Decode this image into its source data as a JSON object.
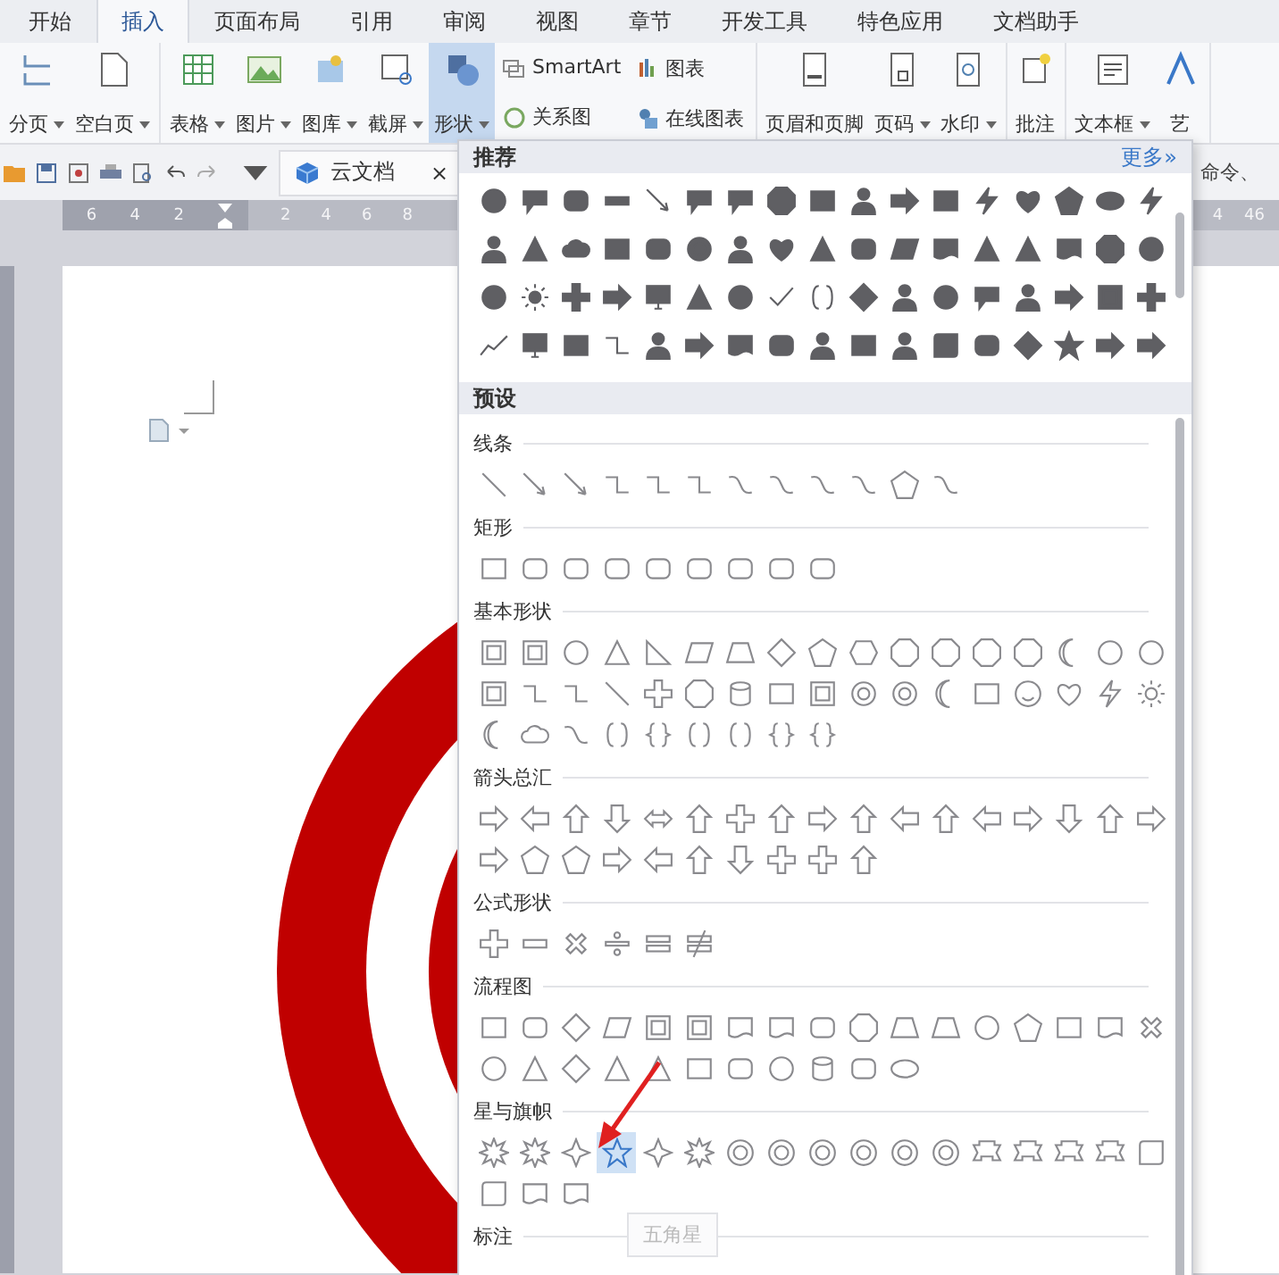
{
  "tabs": [
    {
      "label": "开始",
      "selected": false
    },
    {
      "label": "插入",
      "selected": true
    },
    {
      "label": "页面布局",
      "selected": false
    },
    {
      "label": "引用",
      "selected": false
    },
    {
      "label": "审阅",
      "selected": false
    },
    {
      "label": "视图",
      "selected": false
    },
    {
      "label": "章节",
      "selected": false
    },
    {
      "label": "开发工具",
      "selected": false
    },
    {
      "label": "特色应用",
      "selected": false
    },
    {
      "label": "文档助手",
      "selected": false
    }
  ],
  "ribbon_groups": [
    [
      {
        "kind": "large",
        "label": "分页",
        "dropdown": true,
        "selected": false
      },
      {
        "kind": "large",
        "label": "空白页",
        "dropdown": true,
        "selected": false
      }
    ],
    [
      {
        "kind": "large",
        "label": "表格",
        "dropdown": true,
        "selected": false
      },
      {
        "kind": "large",
        "label": "图片",
        "dropdown": true,
        "selected": false
      },
      {
        "kind": "large",
        "label": "图库",
        "dropdown": true,
        "selected": false
      },
      {
        "kind": "large",
        "label": "截屏",
        "dropdown": true,
        "selected": false
      },
      {
        "kind": "large",
        "label": "形状",
        "dropdown": true,
        "selected": true
      },
      {
        "kind": "small",
        "label": "SmartArt"
      },
      {
        "kind": "small",
        "label": "关系图"
      },
      {
        "kind": "small",
        "label": "图表"
      },
      {
        "kind": "small",
        "label": "在线图表"
      }
    ],
    [
      {
        "kind": "large",
        "label": "页眉和页脚",
        "dropdown": false,
        "selected": false
      },
      {
        "kind": "large",
        "label": "页码",
        "dropdown": true,
        "selected": false
      },
      {
        "kind": "large",
        "label": "水印",
        "dropdown": true,
        "selected": false
      }
    ],
    [
      {
        "kind": "large",
        "label": "批注",
        "dropdown": false,
        "selected": false
      }
    ],
    [
      {
        "kind": "large",
        "label": "文本框",
        "dropdown": true,
        "selected": false
      },
      {
        "kind": "large",
        "label": "艺",
        "dropdown": false,
        "selected": false
      }
    ]
  ],
  "quick_bar": {
    "doc_tab": "云文档",
    "close": "×",
    "search_placeholder": "命令、"
  },
  "ruler": {
    "left_numbers": [
      "6",
      "4",
      "2"
    ],
    "right_numbers": [
      "2",
      "4",
      "6",
      "8"
    ],
    "far_numbers": [
      "4",
      "46"
    ]
  },
  "shapes_panel": {
    "recommended_title": "推荐",
    "more_link": "更多»",
    "preset_title": "预设",
    "sections": [
      {
        "title": "线条"
      },
      {
        "title": "矩形"
      },
      {
        "title": "基本形状"
      },
      {
        "title": "箭头总汇"
      },
      {
        "title": "公式形状"
      },
      {
        "title": "流程图"
      },
      {
        "title": "星与旗帜",
        "items": [
          {
            "selected": false
          },
          {
            "selected": false
          },
          {
            "selected": false
          },
          {
            "selected": true
          },
          {
            "selected": false
          },
          {
            "selected": false
          },
          {
            "selected": false
          },
          {
            "selected": false
          },
          {
            "selected": false
          },
          {
            "selected": false
          },
          {
            "selected": false
          },
          {
            "selected": false
          },
          {
            "selected": false
          },
          {
            "selected": false
          },
          {
            "selected": false
          },
          {
            "selected": false
          },
          {
            "selected": false
          },
          {
            "selected": false
          },
          {
            "selected": false
          },
          {
            "selected": false
          }
        ]
      },
      {
        "title": "标注"
      }
    ],
    "tooltip": "五角星"
  }
}
